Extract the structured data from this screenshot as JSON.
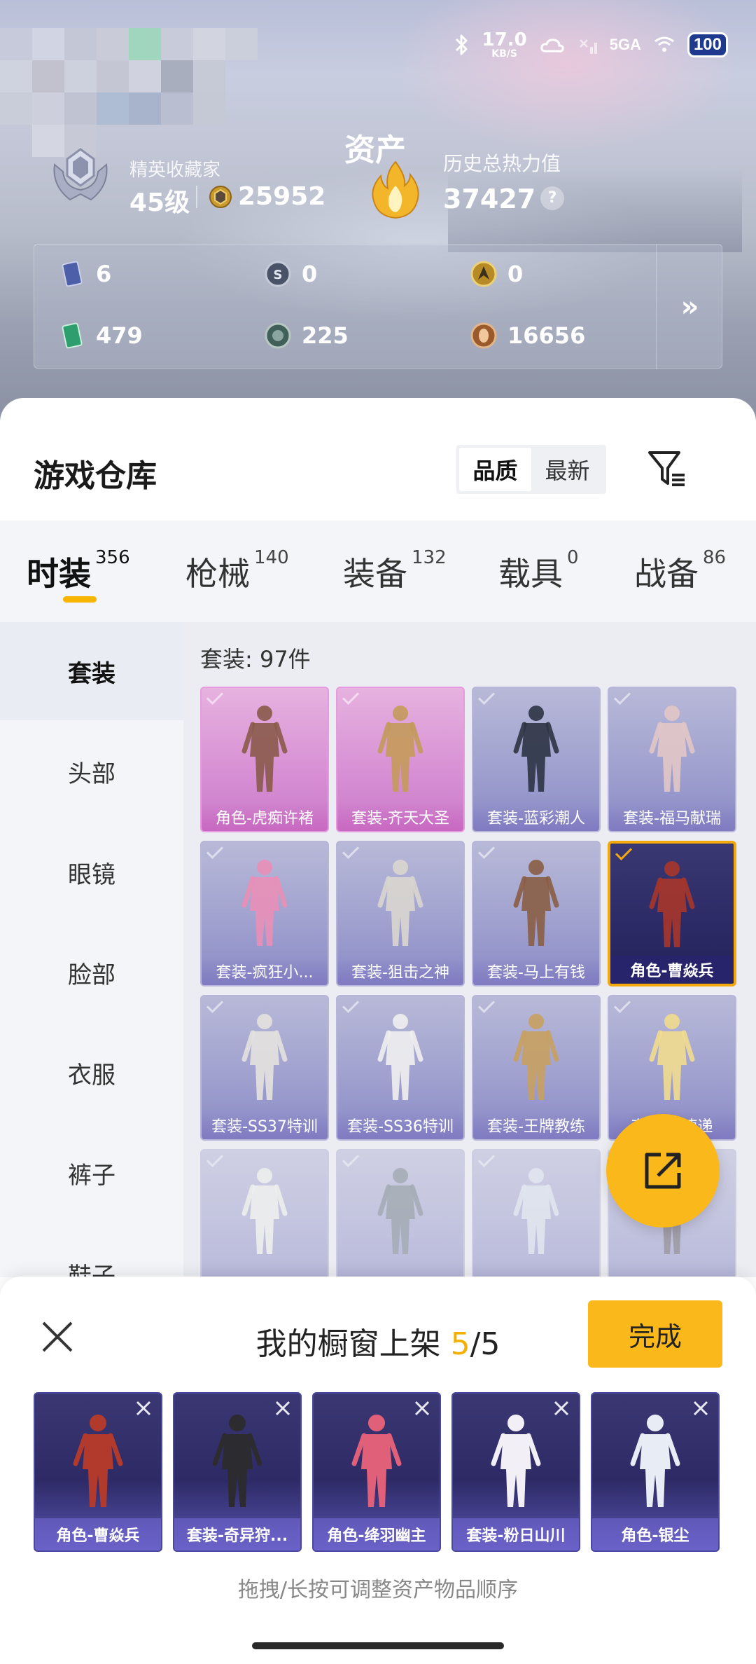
{
  "status_bar": {
    "speed_value": "17.0",
    "speed_unit": "KB/S",
    "network": "5GA",
    "battery": "100"
  },
  "profile": {
    "rank_title": "精英收藏家",
    "level": "45级",
    "coins": "25952"
  },
  "asset_summary": {
    "title": "资产",
    "heat_label": "历史总热力值",
    "heat_value": "37427",
    "help": "?",
    "items": [
      {
        "icon": "card-icon",
        "value": "6",
        "color": "#4d5fa8"
      },
      {
        "icon": "s-coin-icon",
        "value": "0",
        "color": "#4a5268"
      },
      {
        "icon": "gold-medal-icon",
        "value": "0",
        "color": "#b68a24"
      },
      {
        "icon": "green-card-icon",
        "value": "479",
        "color": "#2f9e6e"
      },
      {
        "icon": "orb-icon",
        "value": "225",
        "color": "#3f5f58"
      },
      {
        "icon": "bronze-coin-icon",
        "value": "16656",
        "color": "#9b5a2b"
      }
    ],
    "more": "»"
  },
  "warehouse": {
    "title": "游戏仓库",
    "sort_options": [
      "品质",
      "最新"
    ],
    "active_sort": "品质",
    "filter_icon": "filter-icon"
  },
  "categories": [
    {
      "label": "时装",
      "count": "356"
    },
    {
      "label": "枪械",
      "count": "140"
    },
    {
      "label": "装备",
      "count": "132"
    },
    {
      "label": "载具",
      "count": "0"
    },
    {
      "label": "战备",
      "count": "86"
    }
  ],
  "side_nav": [
    "套装",
    "头部",
    "眼镜",
    "脸部",
    "衣服",
    "裤子",
    "鞋子"
  ],
  "grid": {
    "count_label": "套装: 97件",
    "items": [
      {
        "name": "角色-虎痴许褚",
        "style": "pink"
      },
      {
        "name": "套装-齐天大圣",
        "style": "pink"
      },
      {
        "name": "套装-蓝彩潮人",
        "style": "purple"
      },
      {
        "name": "套装-福马献瑞",
        "style": "purple"
      },
      {
        "name": "套装-疯狂小...",
        "style": "purple"
      },
      {
        "name": "套装-狙击之神",
        "style": "purple"
      },
      {
        "name": "套装-马上有钱",
        "style": "purple"
      },
      {
        "name": "角色-曹焱兵",
        "style": "dark"
      },
      {
        "name": "套装-SS37特训",
        "style": "purple"
      },
      {
        "name": "套装-SS36特训",
        "style": "purple"
      },
      {
        "name": "套装-王牌教练",
        "style": "purple"
      },
      {
        "name": "套装-...速递",
        "style": "purple"
      },
      {
        "name": "",
        "style": "purple"
      },
      {
        "name": "",
        "style": "purple"
      },
      {
        "name": "",
        "style": "purple"
      },
      {
        "name": "",
        "style": "purple"
      }
    ]
  },
  "shelf": {
    "title_prefix": "我的橱窗上架 ",
    "current": "5",
    "total": "/5",
    "done_label": "完成",
    "hint": "拖拽/长按可调整资产物品顺序",
    "items": [
      {
        "name": "角色-曹焱兵"
      },
      {
        "name": "套装-奇异狩..."
      },
      {
        "name": "角色-绛羽幽主"
      },
      {
        "name": "套装-粉日山川"
      },
      {
        "name": "角色-银尘"
      }
    ]
  }
}
